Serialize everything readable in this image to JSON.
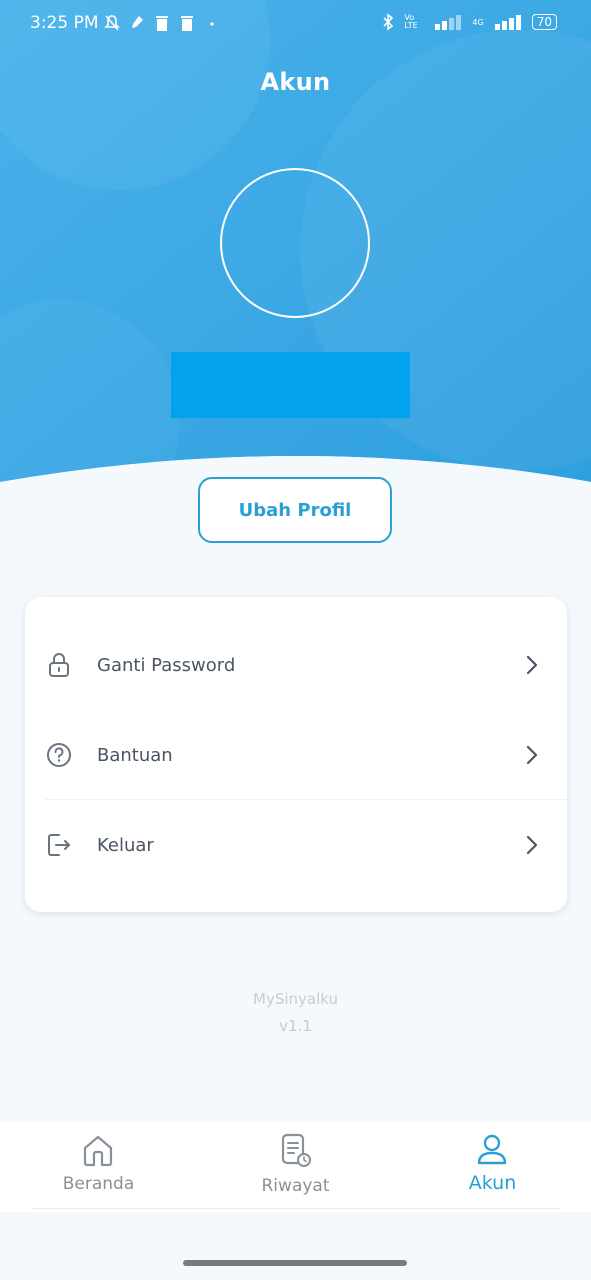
{
  "status_bar": {
    "time": "3:25 PM",
    "battery": "70",
    "network": "4G",
    "volte": "Vo LTE"
  },
  "header": {
    "title": "Akun"
  },
  "profile": {
    "edit_button_label": "Ubah Profil"
  },
  "menu": {
    "items": [
      {
        "label": "Ganti Password",
        "icon": "lock-icon"
      },
      {
        "label": "Bantuan",
        "icon": "help-icon"
      },
      {
        "label": "Keluar",
        "icon": "logout-icon"
      }
    ]
  },
  "footer": {
    "app_name": "MySinyalku",
    "version": "v1.1"
  },
  "bottom_nav": {
    "items": [
      {
        "label": "Beranda",
        "icon": "home-icon",
        "active": false
      },
      {
        "label": "Riwayat",
        "icon": "history-icon",
        "active": false
      },
      {
        "label": "Akun",
        "icon": "account-icon",
        "active": true
      }
    ]
  },
  "colors": {
    "header_blue": "#3aa7e4",
    "accent": "#2a9fd3",
    "name_block": "#03a2ee"
  }
}
